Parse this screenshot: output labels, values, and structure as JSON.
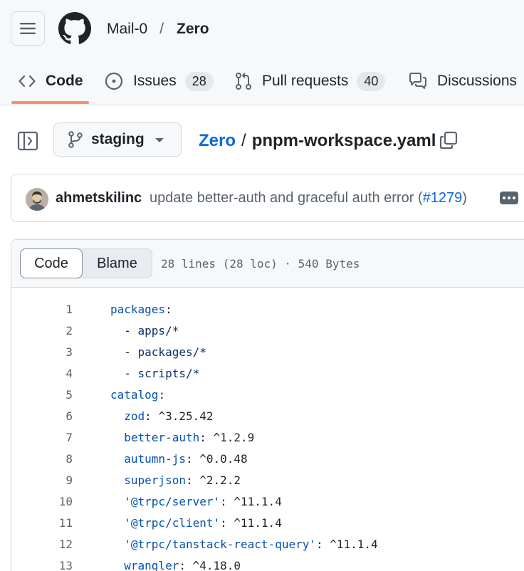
{
  "header": {
    "owner": "Mail-0",
    "separator": "/",
    "repo": "Zero"
  },
  "tabs": [
    {
      "label": "Code",
      "icon": "code-icon"
    },
    {
      "label": "Issues",
      "count": "28",
      "icon": "issue-opened-icon"
    },
    {
      "label": "Pull requests",
      "count": "40",
      "icon": "git-pull-request-icon"
    },
    {
      "label": "Discussions",
      "icon": "comment-discussion-icon"
    }
  ],
  "file_nav": {
    "branch": "staging",
    "path_repo": "Zero",
    "path_sep": "/",
    "file_name": "pnpm-workspace.yaml"
  },
  "commit": {
    "author": "ahmetskilinc",
    "message_prefix": "update better-auth and graceful auth error (",
    "pr_link": "#1279",
    "message_suffix": ")"
  },
  "viewer": {
    "mode_code": "Code",
    "mode_blame": "Blame",
    "meta": "28 lines (28 loc) · 540 Bytes"
  },
  "code": [
    {
      "n": "1",
      "indent": "",
      "key": "packages",
      "punct": ":",
      "value": ""
    },
    {
      "n": "2",
      "indent": "  ",
      "key": "",
      "punct": "- ",
      "value": "apps/*"
    },
    {
      "n": "3",
      "indent": "  ",
      "key": "",
      "punct": "- ",
      "value": "packages/*"
    },
    {
      "n": "4",
      "indent": "  ",
      "key": "",
      "punct": "- ",
      "value": "scripts/*"
    },
    {
      "n": "5",
      "indent": "",
      "key": "catalog",
      "punct": ":",
      "value": ""
    },
    {
      "n": "6",
      "indent": "  ",
      "key": "zod",
      "punct": ": ",
      "value": "^3.25.42"
    },
    {
      "n": "7",
      "indent": "  ",
      "key": "better-auth",
      "punct": ": ",
      "value": "^1.2.9"
    },
    {
      "n": "8",
      "indent": "  ",
      "key": "autumn-js",
      "punct": ": ",
      "value": "^0.0.48"
    },
    {
      "n": "9",
      "indent": "  ",
      "key": "superjson",
      "punct": ": ",
      "value": "^2.2.2"
    },
    {
      "n": "10",
      "indent": "  ",
      "key": "'@trpc/server'",
      "punct": ": ",
      "value": "^11.1.4"
    },
    {
      "n": "11",
      "indent": "  ",
      "key": "'@trpc/client'",
      "punct": ": ",
      "value": "^11.1.4"
    },
    {
      "n": "12",
      "indent": "  ",
      "key": "'@trpc/tanstack-react-query'",
      "punct": ": ",
      "value": "^11.1.4"
    },
    {
      "n": "13",
      "indent": "  ",
      "key": "wrangler",
      "punct": ": ",
      "value": "^4.18.0"
    }
  ]
}
